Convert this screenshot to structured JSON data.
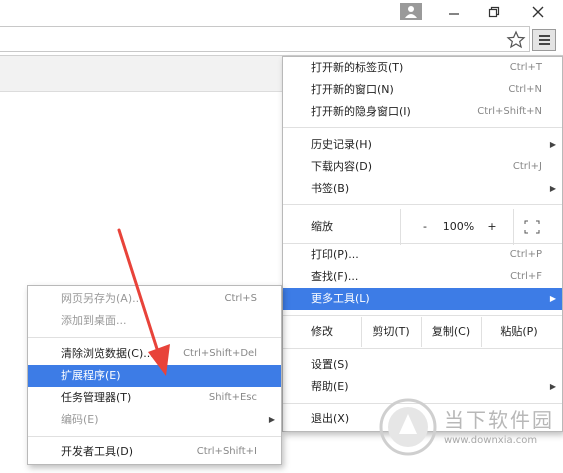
{
  "menu": {
    "new_tab": {
      "label": "打开新的标签页(T)",
      "shortcut": "Ctrl+T"
    },
    "new_window": {
      "label": "打开新的窗口(N)",
      "shortcut": "Ctrl+N"
    },
    "new_incognito": {
      "label": "打开新的隐身窗口(I)",
      "shortcut": "Ctrl+Shift+N"
    },
    "history": {
      "label": "历史记录(H)"
    },
    "downloads": {
      "label": "下载内容(D)",
      "shortcut": "Ctrl+J"
    },
    "bookmarks": {
      "label": "书签(B)"
    },
    "zoom": {
      "label": "缩放",
      "minus": "-",
      "level": "100%",
      "plus": "+"
    },
    "print": {
      "label": "打印(P)...",
      "shortcut": "Ctrl+P"
    },
    "find": {
      "label": "查找(F)...",
      "shortcut": "Ctrl+F"
    },
    "more_tools": {
      "label": "更多工具(L)"
    },
    "edit": {
      "label": "修改",
      "cut": "剪切(T)",
      "copy": "复制(C)",
      "paste": "粘贴(P)"
    },
    "settings": {
      "label": "设置(S)"
    },
    "help": {
      "label": "帮助(E)"
    },
    "exit": {
      "label": "退出(X)"
    }
  },
  "submenu": {
    "save_page": {
      "label": "网页另存为(A)...",
      "shortcut": "Ctrl+S"
    },
    "add_to_desktop": {
      "label": "添加到桌面..."
    },
    "clear_data": {
      "label": "清除浏览数据(C)...",
      "shortcut": "Ctrl+Shift+Del"
    },
    "extensions": {
      "label": "扩展程序(E)"
    },
    "task_manager": {
      "label": "任务管理器(T)",
      "shortcut": "Shift+Esc"
    },
    "encoding": {
      "label": "编码(E)"
    },
    "dev_tools": {
      "label": "开发者工具(D)",
      "shortcut": "Ctrl+Shift+I"
    }
  },
  "watermark": {
    "title": "当下软件园",
    "url": "www.downxia.com"
  },
  "colors": {
    "highlight": "#3d7ce6",
    "annotation_arrow": "#e8433a"
  }
}
